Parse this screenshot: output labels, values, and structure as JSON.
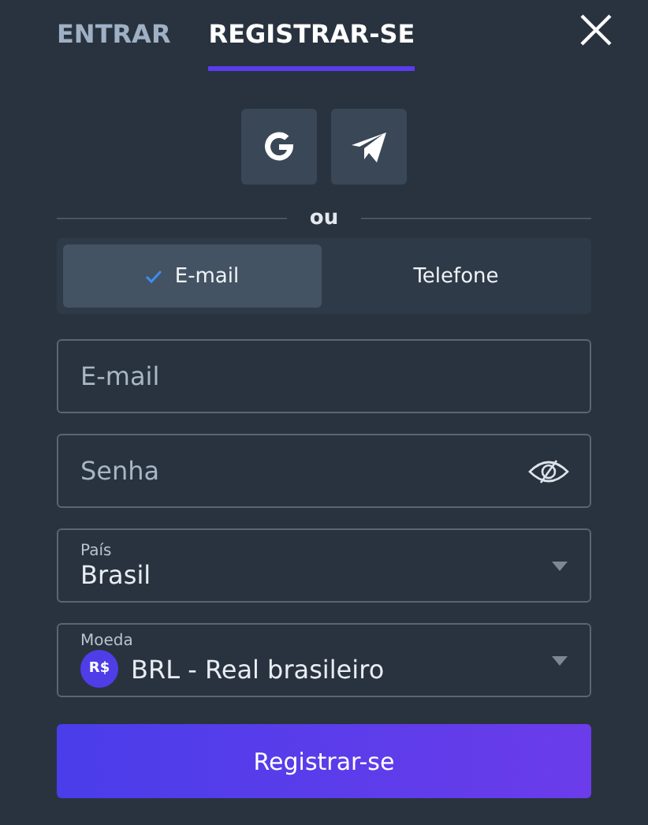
{
  "tabs": [
    {
      "label": "ENTRAR",
      "selected": false
    },
    {
      "label": "REGISTRAR-SE",
      "selected": true
    }
  ],
  "social_buttons": [
    {
      "kind": "google"
    },
    {
      "kind": "telegram"
    }
  ],
  "divider": "ou",
  "method_toggle": [
    {
      "label": "E-mail",
      "selected": true
    },
    {
      "label": "Telefone",
      "selected": false
    }
  ],
  "email": {
    "placeholder": "E-mail"
  },
  "password": {
    "placeholder": "Senha"
  },
  "country": {
    "label": "País",
    "value": "Brasil"
  },
  "currency": {
    "label": "Moeda",
    "badge": "R$",
    "value": "BRL - Real brasileiro"
  },
  "submit": "Registrar-se"
}
